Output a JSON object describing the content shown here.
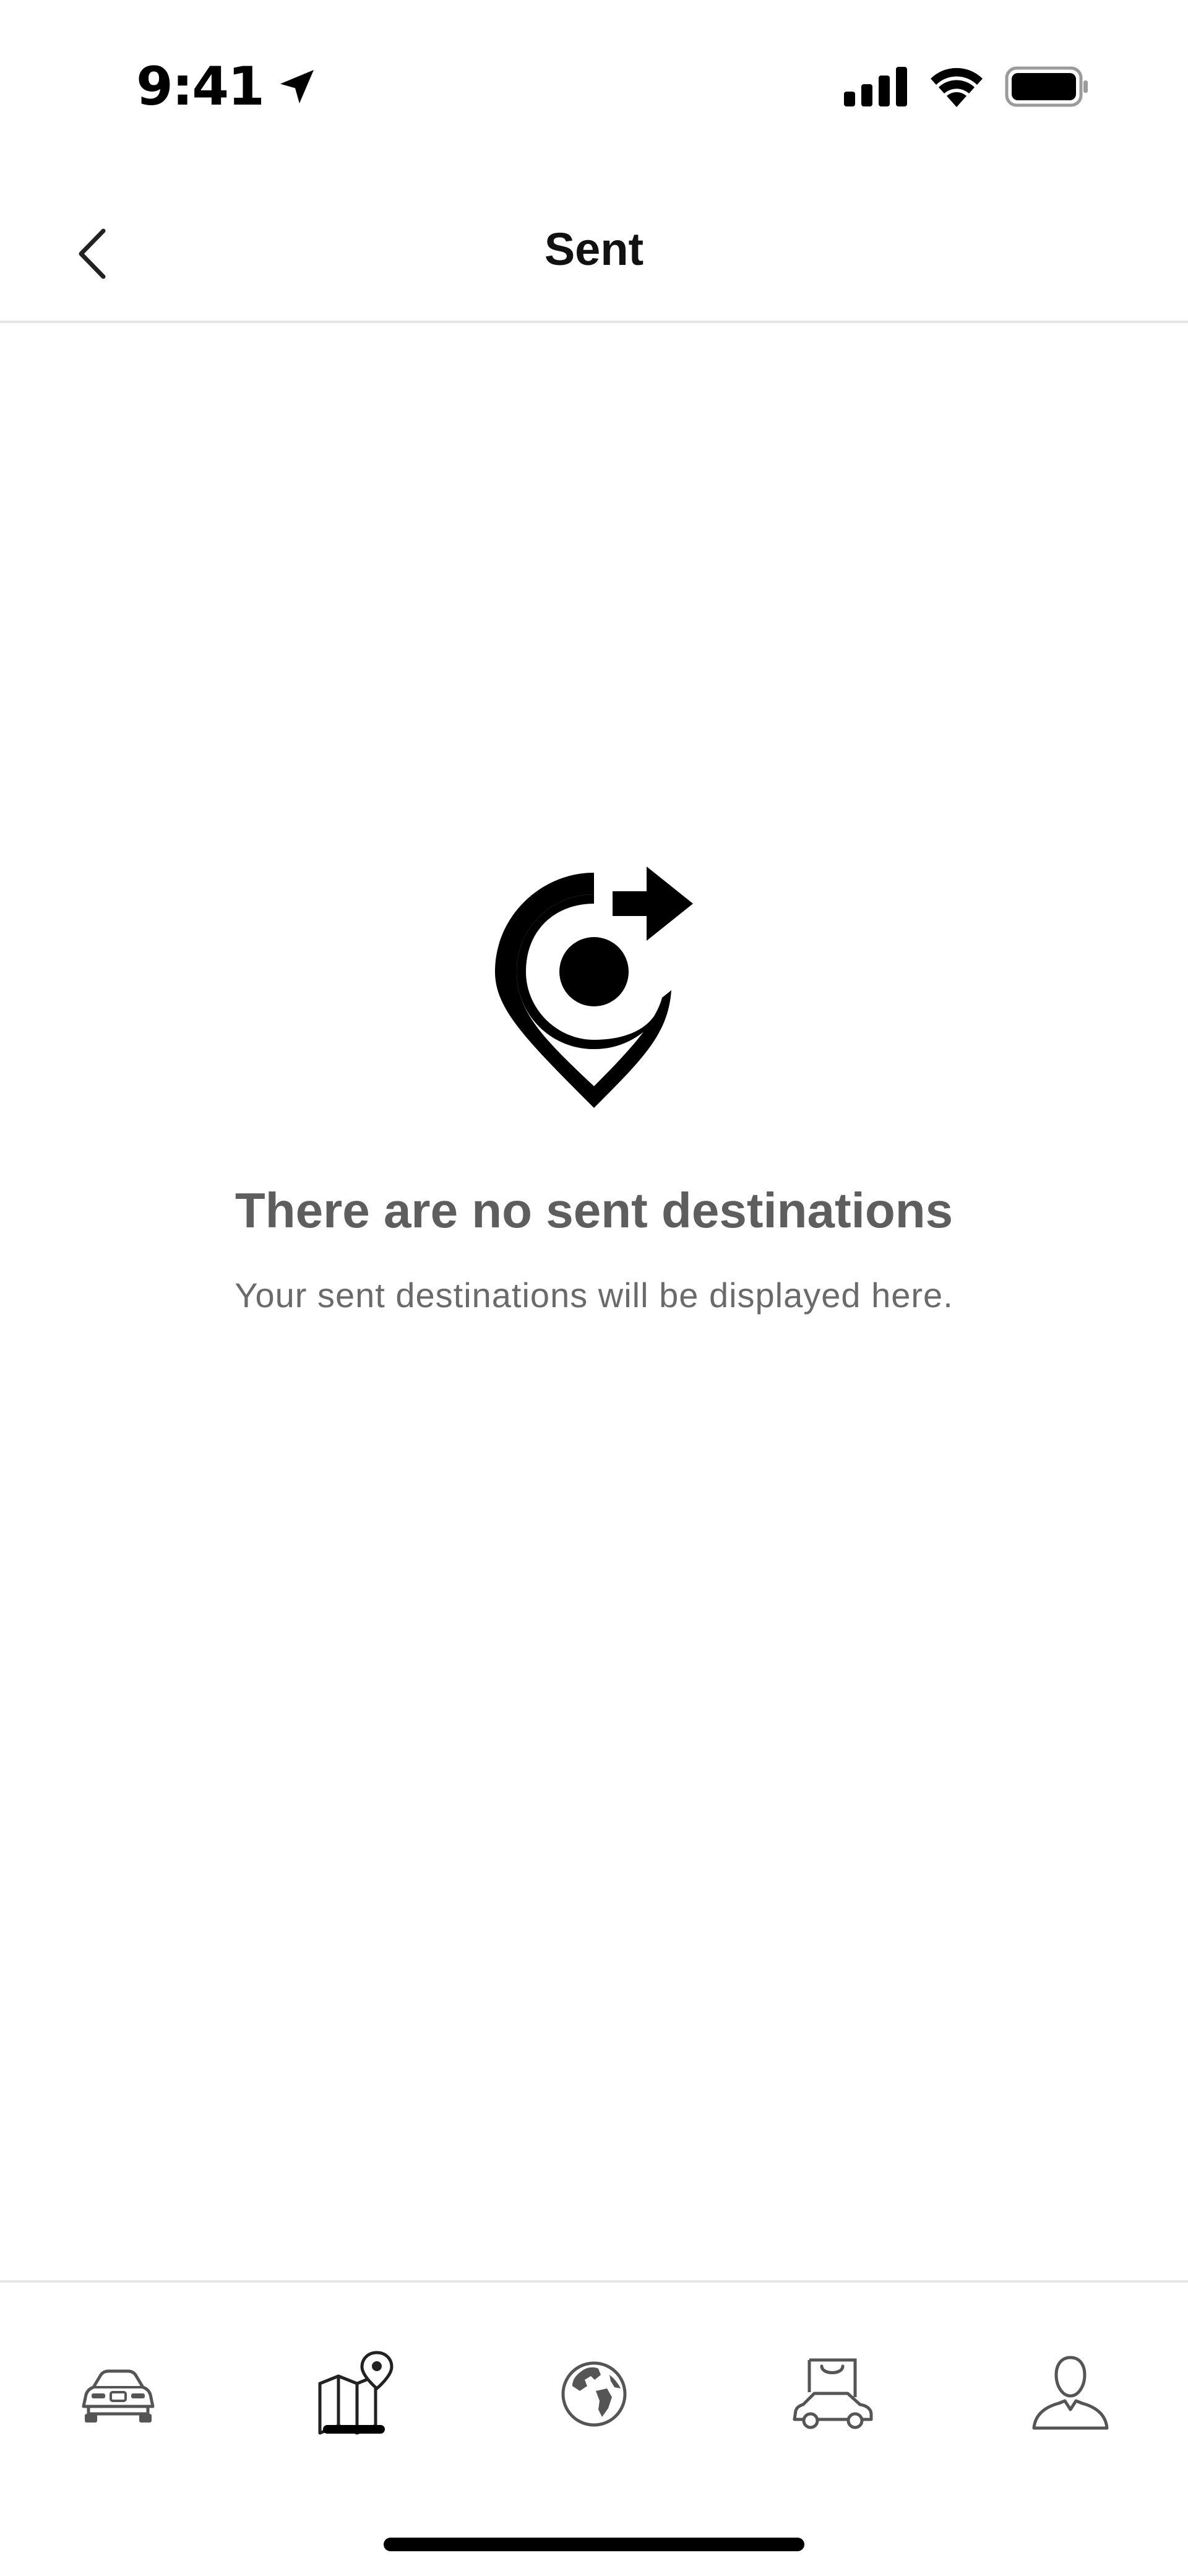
{
  "status_bar": {
    "time": "9:41",
    "icons": [
      "location-arrow-icon",
      "cellular-signal-icon",
      "wifi-icon",
      "battery-icon"
    ]
  },
  "header": {
    "title": "Sent",
    "back_icon": "chevron-left-icon"
  },
  "empty_state": {
    "icon": "send-destination-pin-icon",
    "title": "There are no sent destinations",
    "subtitle": "Your sent destinations will be displayed here."
  },
  "tab_bar": {
    "active_index": 1,
    "items": [
      {
        "icon": "car-icon"
      },
      {
        "icon": "map-pin-icon"
      },
      {
        "icon": "globe-icon"
      },
      {
        "icon": "shop-car-icon"
      },
      {
        "icon": "profile-icon"
      }
    ]
  },
  "colors": {
    "title_gray": "#5e5e5e",
    "subtitle_gray": "#6a6a6a",
    "divider": "#e6e6e6",
    "icon_gray": "#555555",
    "black": "#000000"
  }
}
